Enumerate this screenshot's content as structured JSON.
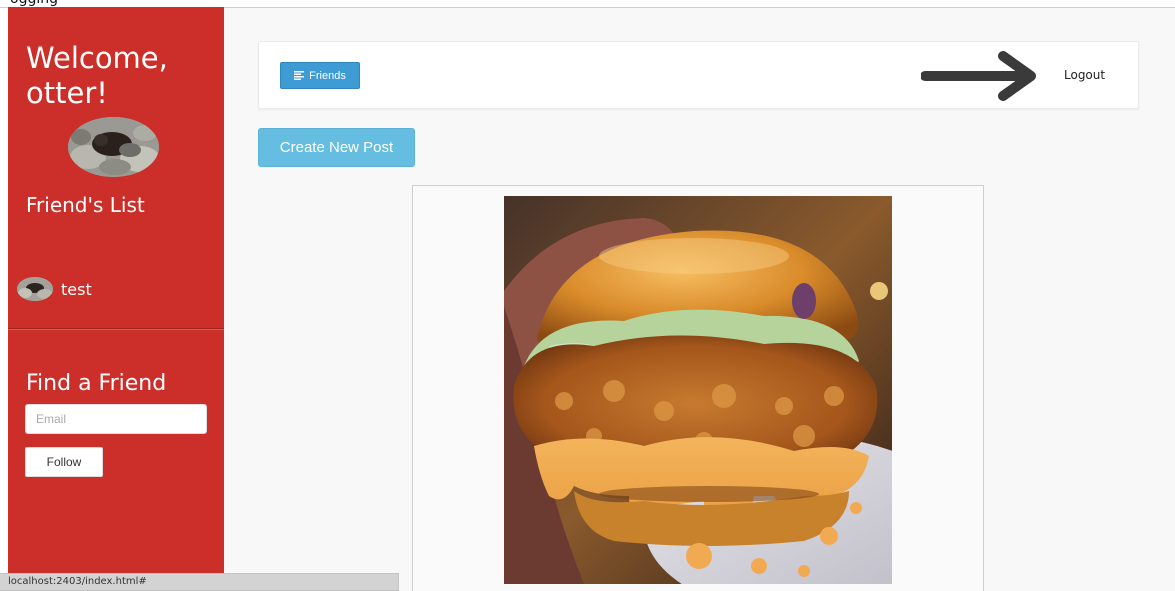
{
  "header": {
    "top_text": "ogging"
  },
  "sidebar": {
    "welcome": "Welcome, otter!",
    "friends_heading": "Friend's List",
    "friends": [
      {
        "name": "test"
      }
    ],
    "find_heading": "Find a Friend",
    "email_placeholder": "Email",
    "follow_label": "Follow"
  },
  "topbar": {
    "friends_button": "Friends",
    "friends_icon": "list-icon",
    "arrow_icon": "right-arrow-icon",
    "logout_label": "Logout"
  },
  "main": {
    "create_post_label": "Create New Post",
    "post_image": "fried chicken sandwich"
  },
  "status_bar": {
    "url": "localhost:2403/index.html#"
  },
  "colors": {
    "sidebar": "#cc2f2a",
    "primary_button": "#3f9bd3",
    "create_button": "#65bde1",
    "page_background": "#f8f8f8"
  }
}
